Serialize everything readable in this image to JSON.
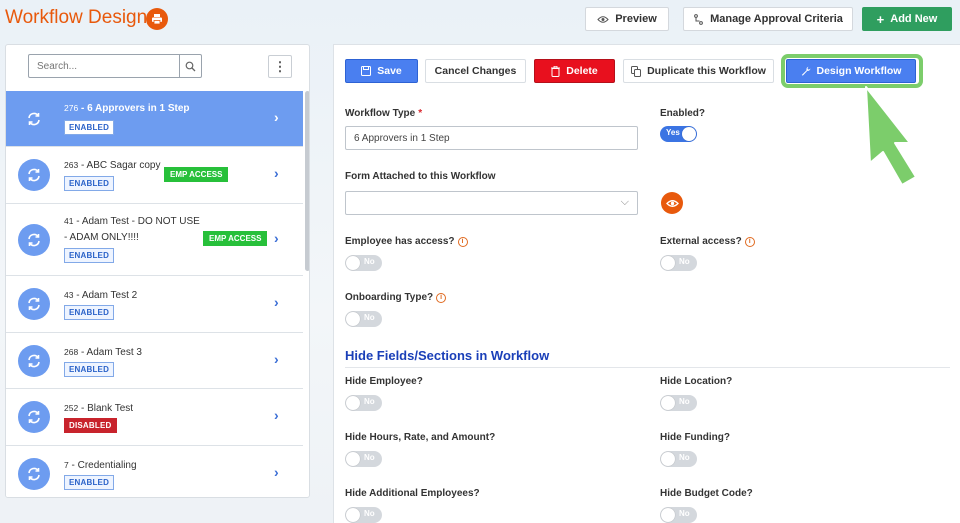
{
  "header": {
    "title": "Workflow Designer",
    "preview_label": "Preview",
    "manage_label": "Manage Approval Criteria",
    "add_label": "Add New"
  },
  "sidebar": {
    "search_placeholder": "Search...",
    "items": [
      {
        "num": "276",
        "name": "6 Approvers in 1 Step",
        "status": "ENABLED",
        "selected": true
      },
      {
        "num": "263",
        "name": "ABC Sagar copy",
        "status": "ENABLED",
        "tag": "EMP ACCESS"
      },
      {
        "num": "41",
        "name_line1": "Adam Test - DO NOT USE",
        "name_line2": "- ADAM ONLY!!!!",
        "status": "ENABLED",
        "tag": "EMP ACCESS"
      },
      {
        "num": "43",
        "name": "Adam Test 2",
        "status": "ENABLED"
      },
      {
        "num": "268",
        "name": "Adam Test 3",
        "status": "ENABLED"
      },
      {
        "num": "252",
        "name": "Blank Test",
        "status": "DISABLED"
      },
      {
        "num": "7",
        "name": "Credentialing",
        "status": "ENABLED"
      }
    ]
  },
  "toolbar": {
    "save_label": "Save",
    "cancel_label": "Cancel Changes",
    "delete_label": "Delete",
    "duplicate_label": "Duplicate this Workflow",
    "design_label": "Design Workflow"
  },
  "form": {
    "workflow_type_label": "Workflow Type",
    "required_mark": "*",
    "workflow_type_value": "6 Approvers in 1 Step",
    "enabled_label": "Enabled?",
    "enabled_value": "Yes",
    "form_attached_label": "Form Attached to this Workflow",
    "form_attached_value": "",
    "employee_access_label": "Employee has access?",
    "employee_access_value": "No",
    "external_access_label": "External access?",
    "external_access_value": "No",
    "onboarding_label": "Onboarding Type?",
    "onboarding_value": "No"
  },
  "hide_section": {
    "title": "Hide Fields/Sections in Workflow",
    "hide_employee_label": "Hide Employee?",
    "hide_employee_value": "No",
    "hide_location_label": "Hide Location?",
    "hide_location_value": "No",
    "hide_hours_label": "Hide Hours, Rate, and Amount?",
    "hide_hours_value": "No",
    "hide_funding_label": "Hide Funding?",
    "hide_funding_value": "No",
    "hide_additional_label": "Hide Additional Employees?",
    "hide_additional_value": "No",
    "hide_budget_label": "Hide Budget Code?",
    "hide_budget_value": "No"
  },
  "colors": {
    "brand_orange": "#e8590c",
    "primary_blue": "#4a7ff0",
    "selected_row": "#6d9cf0",
    "success_green": "#2f9e5f",
    "emp_green": "#27c03a",
    "danger_red": "#e8101e",
    "highlight_green": "#7ccd6b"
  }
}
